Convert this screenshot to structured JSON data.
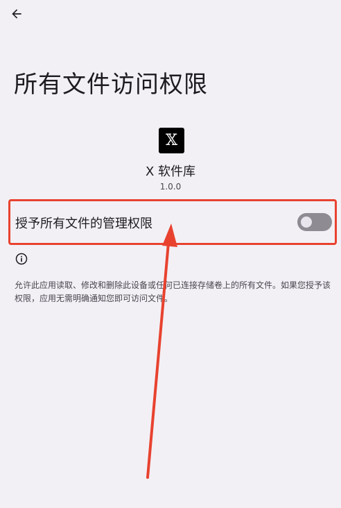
{
  "header": {
    "back_icon": "arrow-left-icon"
  },
  "page": {
    "title": "所有文件访问权限"
  },
  "app": {
    "icon": "x-logo-icon",
    "icon_glyph": "𝕏",
    "name": "X 软件库",
    "version": "1.0.0"
  },
  "permission": {
    "label": "授予所有文件的管理权限",
    "toggle_state": "off"
  },
  "info": {
    "icon": "info-icon",
    "description": "允许此应用读取、修改和删除此设备或任何已连接存储卷上的所有文件。如果您授予该权限，应用无需明确通知您即可访问文件。"
  },
  "colors": {
    "background": "#f3f0f5",
    "annotation": "#e8422f",
    "toggle_off_track": "#8e8b93"
  }
}
